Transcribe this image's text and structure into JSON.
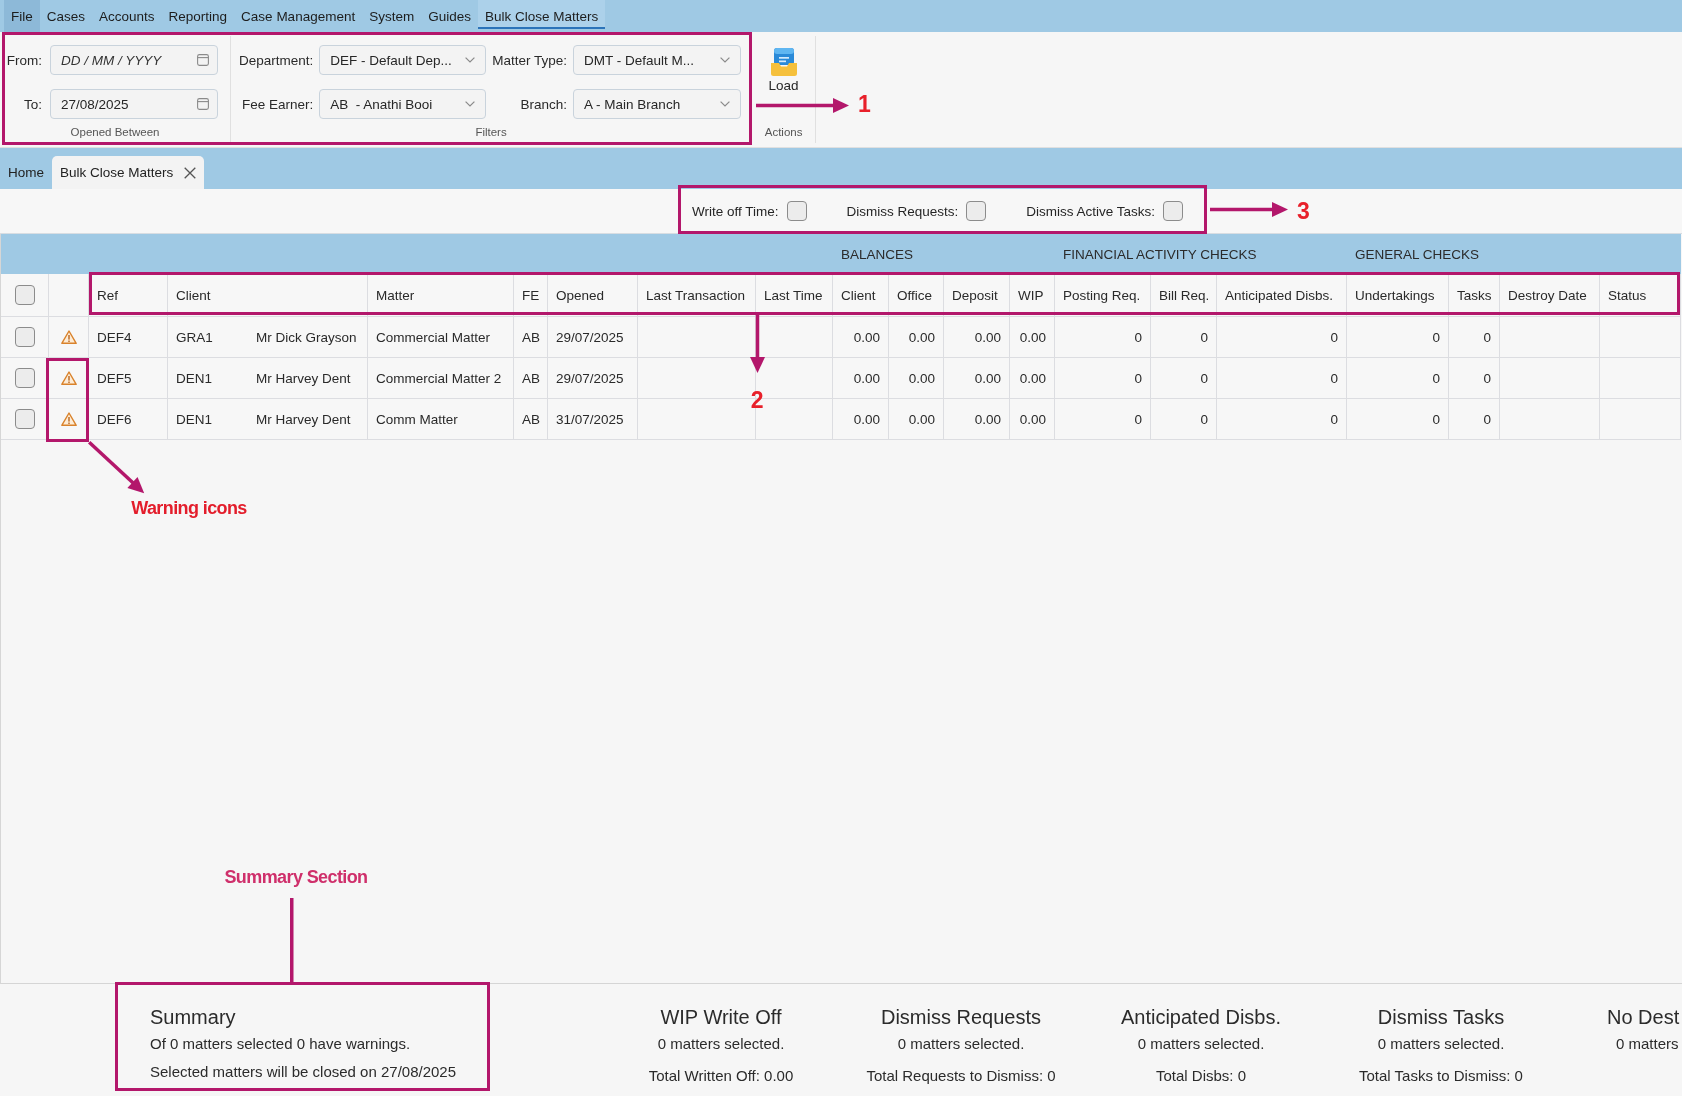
{
  "menu_bar": {
    "items": [
      {
        "label": "File",
        "selected": false,
        "hovered": true
      },
      {
        "label": "Cases",
        "selected": false,
        "hovered": false
      },
      {
        "label": "Accounts",
        "selected": false,
        "hovered": false
      },
      {
        "label": "Reporting",
        "selected": false,
        "hovered": false
      },
      {
        "label": "Case Management",
        "selected": false,
        "hovered": false
      },
      {
        "label": "System",
        "selected": false,
        "hovered": false
      },
      {
        "label": "Guides",
        "selected": false,
        "hovered": false
      },
      {
        "label": "Bulk Close Matters",
        "selected": true,
        "hovered": false
      }
    ]
  },
  "ribbon": {
    "groups": [
      {
        "kind": "dates",
        "label": "Opened Between",
        "fields": [
          {
            "label": "From:",
            "placeholder": "DD / MM / YYYY"
          },
          {
            "label": "To:",
            "value": "27/08/2025"
          }
        ]
      },
      {
        "kind": "filters",
        "label": "Filters",
        "fields": [
          {
            "label": "Department:",
            "value": "DEF - Default Dep..."
          },
          {
            "label": "Matter Type:",
            "value": "DMT - Default M..."
          },
          {
            "label": "Fee Earner:",
            "value": "AB  - Anathi Booi"
          },
          {
            "label": "Branch:",
            "value": "A - Main Branch"
          }
        ]
      },
      {
        "kind": "actions",
        "label": "Actions",
        "buttons": [
          {
            "label": "Load"
          }
        ]
      }
    ],
    "annotation": {
      "label": "1"
    }
  },
  "tabs": [
    {
      "label": "Home",
      "selected": false,
      "closable": false
    },
    {
      "label": "Bulk Close Matters",
      "selected": true,
      "closable": true
    }
  ],
  "options": {
    "items": [
      {
        "label": "Write off Time:",
        "checked": false
      },
      {
        "label": "Dismiss Requests:",
        "checked": false
      },
      {
        "label": "Dismiss Active Tasks:",
        "checked": false
      }
    ],
    "annotation": {
      "label": "3"
    }
  },
  "table": {
    "column_groups": [
      {
        "columns": [
          {
            "kind": "select",
            "checked": false
          },
          {
            "kind": "warning"
          },
          {
            "kind": "text",
            "label": "Ref"
          },
          {
            "kind": "client",
            "label": "Client"
          },
          {
            "kind": "text",
            "label": "Matter"
          },
          {
            "kind": "text",
            "label": "FE"
          },
          {
            "kind": "text",
            "label": "Opened"
          },
          {
            "kind": "text",
            "label": "Last Transaction"
          },
          {
            "kind": "text",
            "label": "Last Time"
          }
        ]
      },
      {
        "label": "BALANCES",
        "columns": [
          {
            "kind": "number",
            "label": "Client"
          },
          {
            "kind": "number",
            "label": "Office"
          },
          {
            "kind": "number",
            "label": "Deposit"
          },
          {
            "kind": "number",
            "label": "WIP"
          }
        ]
      },
      {
        "label": "FINANCIAL ACTIVITY CHECKS",
        "columns": [
          {
            "kind": "number",
            "label": "Posting Req."
          },
          {
            "kind": "number",
            "label": "Bill Req."
          },
          {
            "kind": "number",
            "label": "Anticipated Disbs."
          }
        ]
      },
      {
        "label": "GENERAL CHECKS",
        "columns": [
          {
            "kind": "number",
            "label": "Undertakings"
          },
          {
            "kind": "number",
            "label": "Tasks"
          },
          {
            "kind": "text",
            "label": "Destroy Date"
          }
        ]
      },
      {
        "columns": [
          {
            "kind": "text",
            "label": "Status"
          }
        ]
      }
    ],
    "rows": [
      {
        "checked": false,
        "warning": true,
        "callout": false,
        "ref": "DEF4",
        "client": {
          "code": "GRA1",
          "name": "Mr Dick Grayson"
        },
        "matter": "Commercial Matter",
        "fe": "AB",
        "opened": "29/07/2025",
        "client_balance": "0.00",
        "office": "0.00",
        "deposit": "0.00",
        "wip": "0.00",
        "posting_req": "0",
        "bill_req": "0",
        "anticipated_disbs": "0",
        "undertakings": "0",
        "tasks": "0"
      },
      {
        "checked": false,
        "warning": true,
        "callout": true,
        "ref": "DEF5",
        "client": {
          "code": "DEN1",
          "name": "Mr Harvey Dent"
        },
        "matter": "Commercial Matter 2",
        "fe": "AB",
        "opened": "29/07/2025",
        "client_balance": "0.00",
        "office": "0.00",
        "deposit": "0.00",
        "wip": "0.00",
        "posting_req": "0",
        "bill_req": "0",
        "anticipated_disbs": "0",
        "undertakings": "0",
        "tasks": "0"
      },
      {
        "checked": false,
        "warning": true,
        "callout": true,
        "ref": "DEF6",
        "client": {
          "code": "DEN1",
          "name": "Mr Harvey Dent"
        },
        "matter": "Comm Matter",
        "fe": "AB",
        "opened": "31/07/2025",
        "client_balance": "0.00",
        "office": "0.00",
        "deposit": "0.00",
        "wip": "0.00",
        "posting_req": "0",
        "bill_req": "0",
        "anticipated_disbs": "0",
        "undertakings": "0",
        "tasks": "0"
      }
    ],
    "header_annotation": {
      "label": "2"
    },
    "warning_annotation": {
      "label": "Warning icons"
    }
  },
  "summary": {
    "title": "Summary",
    "lines": [
      "Of 0 matters selected 0 have warnings.",
      "Selected matters will be closed on 27/08/2025"
    ],
    "annotation": {
      "label": "Summary Section"
    }
  },
  "summary_columns": [
    {
      "title": "WIP Write Off",
      "count_text": "0 matters selected.",
      "total": "Total Written Off: 0.00"
    },
    {
      "title": "Dismiss Requests",
      "count_text": "0 matters selected.",
      "total": "Total Requests to Dismiss: 0"
    },
    {
      "title": "Anticipated Disbs.",
      "count_text": "0 matters selected.",
      "total": "Total Disbs: 0"
    },
    {
      "title": "Dismiss Tasks",
      "count_text": "0 matters selected.",
      "total": "Total Tasks to Dismiss: 0"
    },
    {
      "title": "No Dest",
      "count_text": "0 matters"
    }
  ]
}
